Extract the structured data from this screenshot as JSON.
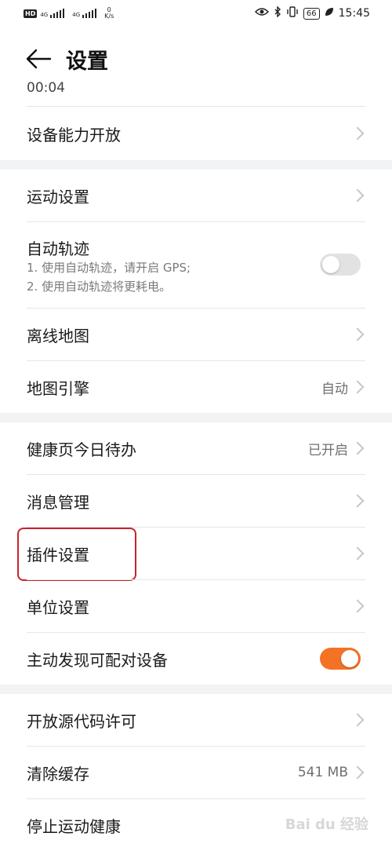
{
  "status_bar": {
    "hd_badge": "HD",
    "sim1_label": "4G",
    "sim2_label": "4G",
    "net_speed_value": "0",
    "net_speed_unit": "K/s",
    "battery": "66",
    "time": "15:45"
  },
  "header": {
    "title": "设置"
  },
  "peek_text": "00:04",
  "items": {
    "device_open": {
      "label": "设备能力开放"
    },
    "sport_settings": {
      "label": "运动设置"
    },
    "auto_track": {
      "label": "自动轨迹",
      "desc1": "1. 使用自动轨迹，请开启 GPS;",
      "desc2": "2. 使用自动轨迹将更耗电。",
      "enabled": false
    },
    "offline_map": {
      "label": "离线地图"
    },
    "map_engine": {
      "label": "地图引擎",
      "value": "自动"
    },
    "health_todo": {
      "label": "健康页今日待办",
      "value": "已开启"
    },
    "message_mgmt": {
      "label": "消息管理"
    },
    "plugin_settings": {
      "label": "插件设置"
    },
    "unit_settings": {
      "label": "单位设置"
    },
    "auto_discover": {
      "label": "主动发现可配对设备",
      "enabled": true
    },
    "open_source": {
      "label": "开放源代码许可"
    },
    "clear_cache": {
      "label": "清除缓存",
      "value": "541 MB"
    },
    "stop_health": {
      "label": "停止运动健康"
    }
  },
  "watermark": "Bai du 经验",
  "colors": {
    "accent": "#f37224",
    "highlight_box": "#c8232c",
    "section_gap": "#f1f3f5"
  }
}
